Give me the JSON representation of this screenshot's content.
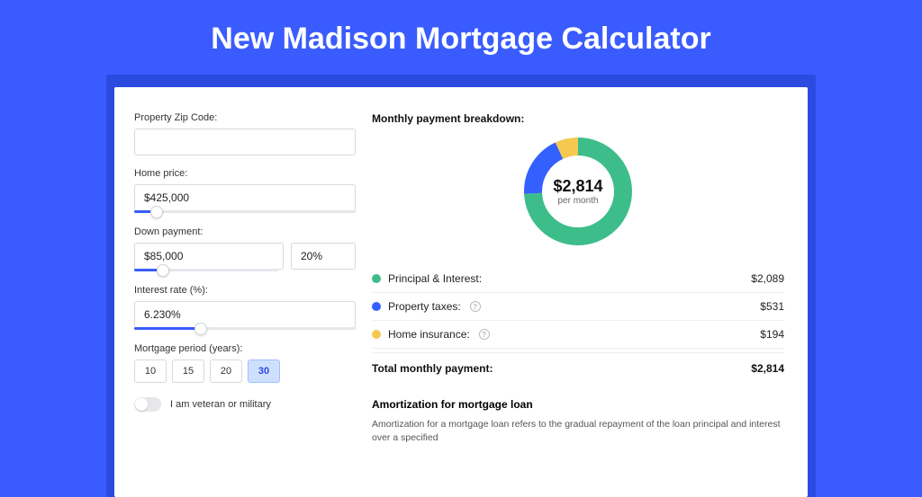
{
  "title": "New Madison Mortgage Calculator",
  "form": {
    "zip": {
      "label": "Property Zip Code:",
      "value": ""
    },
    "price": {
      "label": "Home price:",
      "value": "$425,000"
    },
    "down": {
      "label": "Down payment:",
      "value": "$85,000",
      "pct": "20%"
    },
    "rate": {
      "label": "Interest rate (%):",
      "value": "6.230%"
    },
    "period": {
      "label": "Mortgage period (years):",
      "options": [
        "10",
        "15",
        "20",
        "30"
      ],
      "selected": "30"
    },
    "veteran": {
      "label": "I am veteran or military",
      "on": false
    }
  },
  "breakdown": {
    "title": "Monthly payment breakdown:",
    "center_value": "$2,814",
    "center_sub": "per month",
    "rows": [
      {
        "color": "green",
        "label": "Principal & Interest:",
        "value": "$2,089",
        "info": false
      },
      {
        "color": "blue",
        "label": "Property taxes:",
        "value": "$531",
        "info": true
      },
      {
        "color": "yellow",
        "label": "Home insurance:",
        "value": "$194",
        "info": true
      }
    ],
    "total_label": "Total monthly payment:",
    "total_value": "$2,814"
  },
  "amortization": {
    "title": "Amortization for mortgage loan",
    "text": "Amortization for a mortgage loan refers to the gradual repayment of the loan principal and interest over a specified"
  },
  "chart_data": {
    "type": "pie",
    "title": "Monthly payment breakdown",
    "series": [
      {
        "name": "Principal & Interest",
        "value": 2089,
        "color": "#3dbd8a"
      },
      {
        "name": "Property taxes",
        "value": 531,
        "color": "#3360ff"
      },
      {
        "name": "Home insurance",
        "value": 194,
        "color": "#f5c84f"
      }
    ],
    "total": 2814,
    "center_label": "$2,814 per month"
  }
}
